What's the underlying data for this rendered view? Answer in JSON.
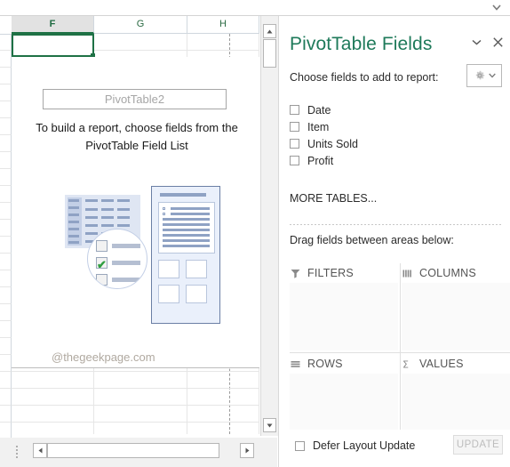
{
  "ribbon": {
    "collapse_icon": "chevron-down-icon"
  },
  "worksheet": {
    "columns": [
      "F",
      "G",
      "H"
    ],
    "selected_column": "F",
    "pivot_placeholder": {
      "name": "PivotTable2",
      "hint": "To build a report, choose fields from the PivotTable Field List",
      "watermark": "@thegeekpage.com"
    },
    "scroll": {
      "up_arrow": "triangle-up-icon",
      "down_arrow": "triangle-down-icon",
      "left_arrow": "triangle-left-icon",
      "right_arrow": "triangle-right-icon"
    }
  },
  "pane": {
    "title": "PivotTable Fields",
    "title_color": "#1e7a5a",
    "menu_icon": "chevron-down-icon",
    "close_icon": "close-icon",
    "choose_label": "Choose fields to add to report:",
    "tools_icon": "gear-icon",
    "tools_caret": "chevron-down-icon",
    "fields": [
      {
        "label": "Date",
        "checked": false
      },
      {
        "label": "Item",
        "checked": false
      },
      {
        "label": "Units Sold",
        "checked": false
      },
      {
        "label": "Profit",
        "checked": false
      }
    ],
    "more_tables": "MORE TABLES...",
    "drag_label": "Drag fields between areas below:",
    "areas": [
      {
        "label": "FILTERS",
        "icon": "filter-funnel-icon",
        "items": []
      },
      {
        "label": "COLUMNS",
        "icon": "columns-icon",
        "items": []
      },
      {
        "label": "ROWS",
        "icon": "rows-icon",
        "items": []
      },
      {
        "label": "VALUES",
        "icon": "sigma-icon",
        "items": []
      }
    ],
    "footer": {
      "defer_label": "Defer Layout Update",
      "defer_checked": false,
      "update_label": "UPDATE",
      "update_enabled": false
    }
  }
}
